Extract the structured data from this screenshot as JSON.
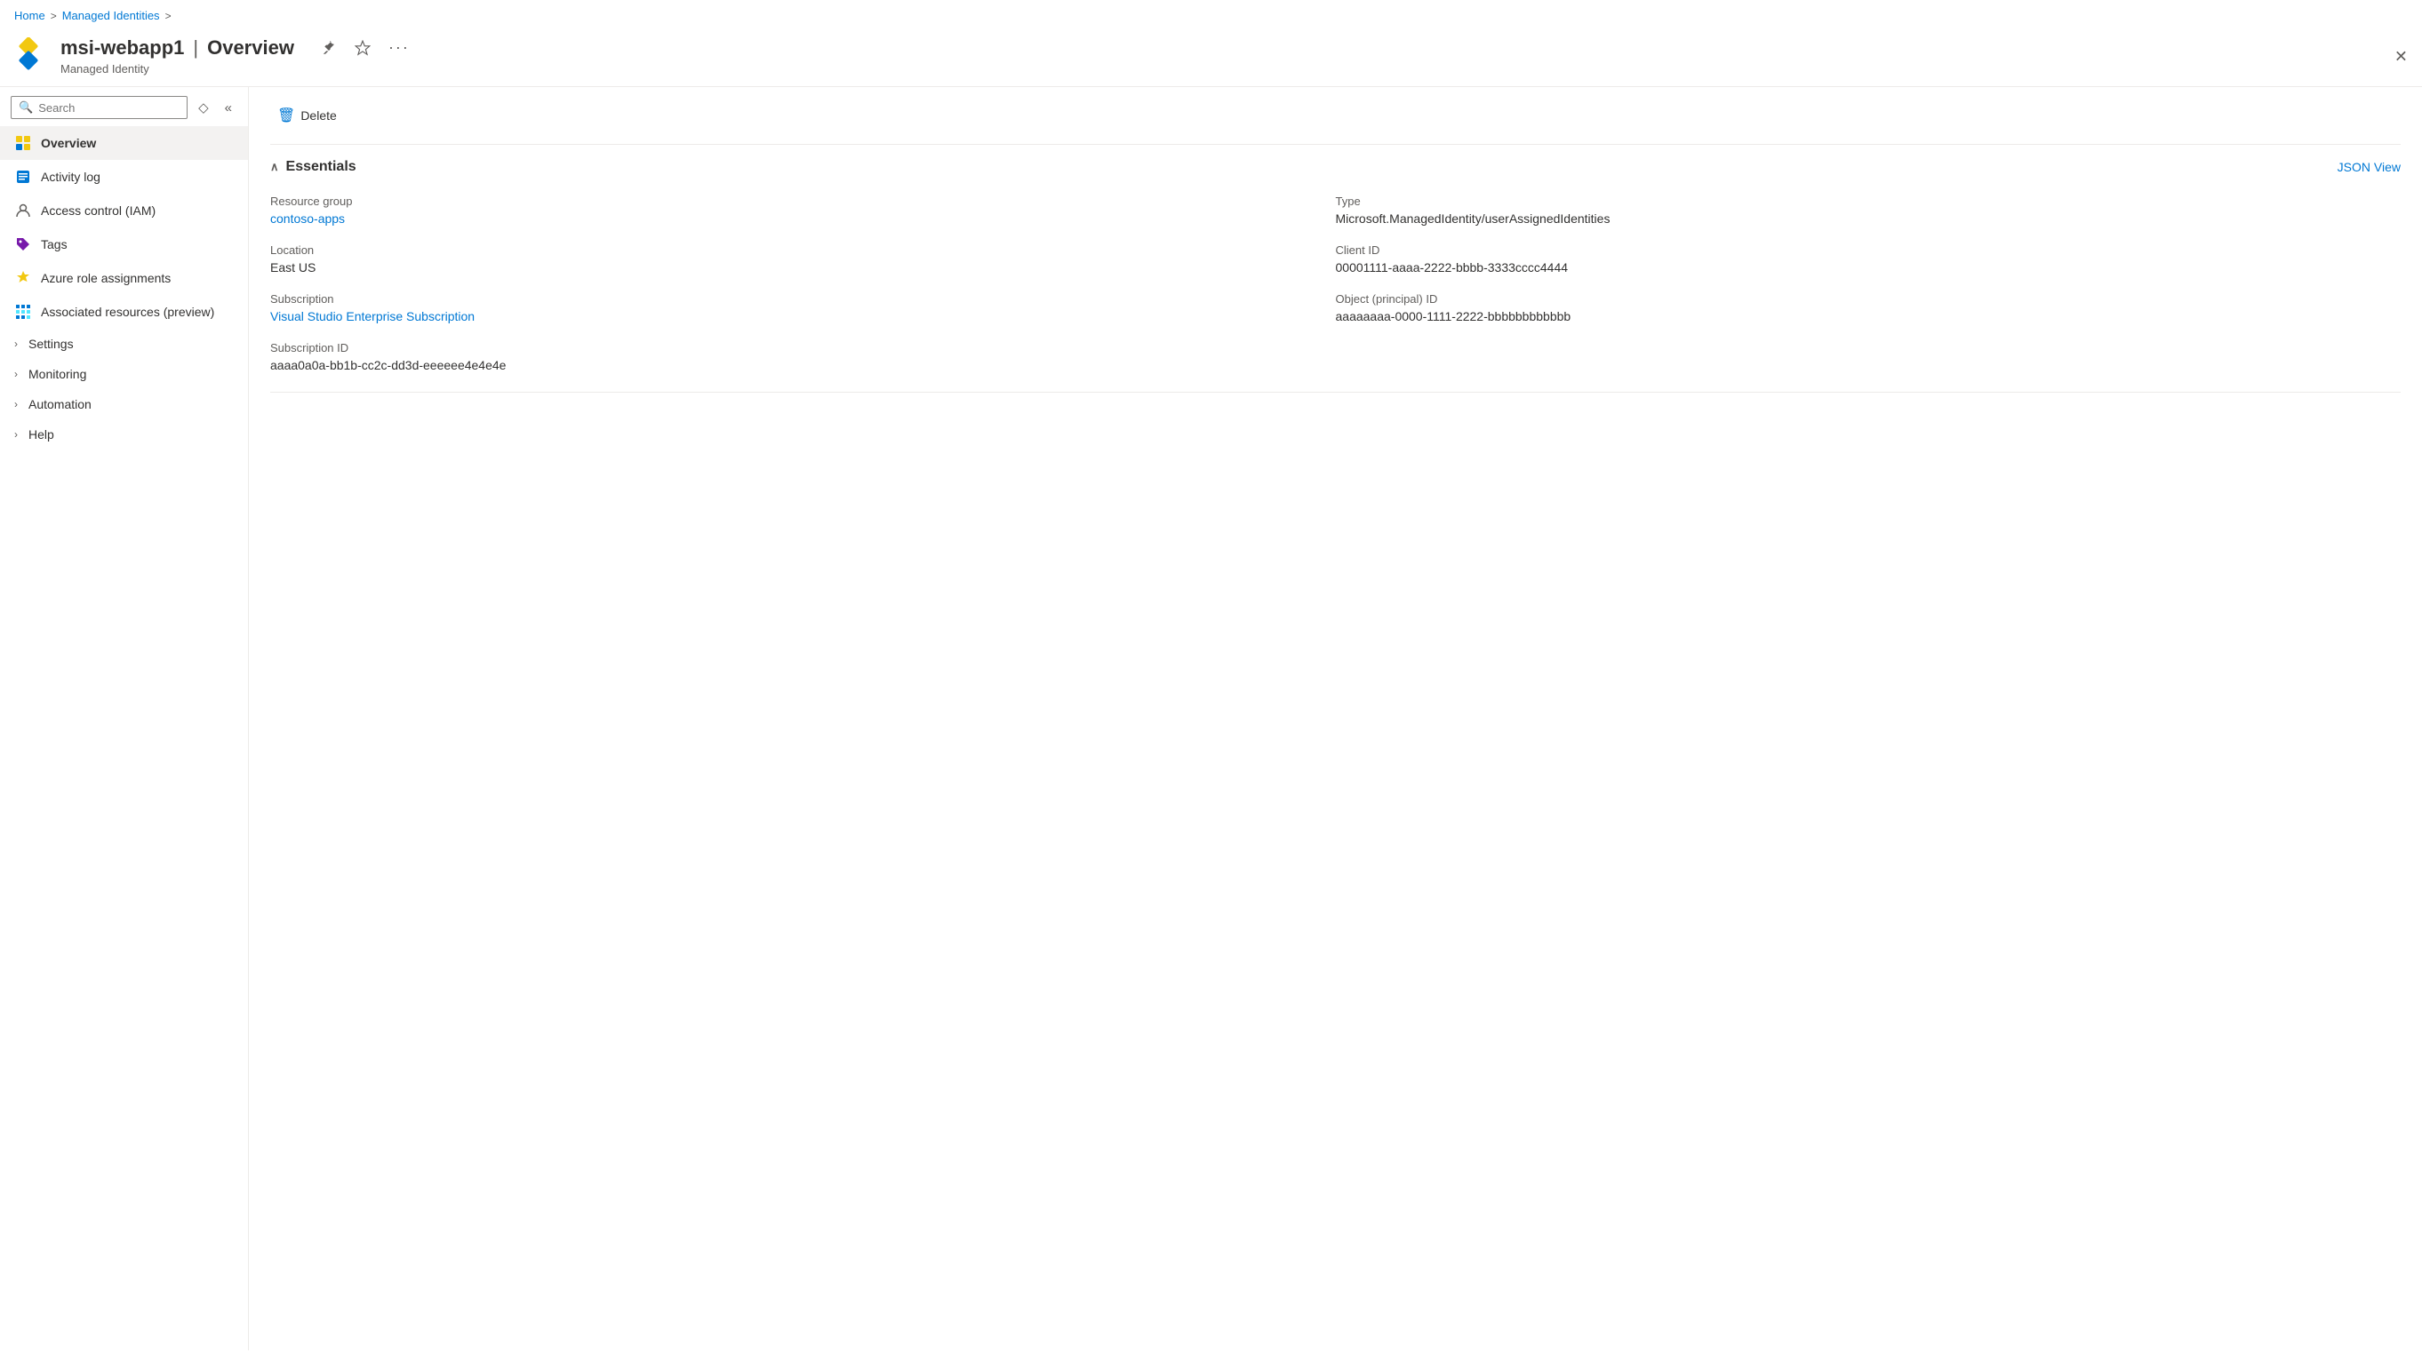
{
  "breadcrumb": {
    "home": "Home",
    "managed_identities": "Managed Identities",
    "sep": ">"
  },
  "header": {
    "resource_name": "msi-webapp1",
    "separator": "|",
    "page_title": "Overview",
    "subtitle": "Managed Identity",
    "pin_tooltip": "Pin to dashboard",
    "star_tooltip": "Favorite",
    "more_tooltip": "More options",
    "close_tooltip": "Close"
  },
  "sidebar": {
    "search_placeholder": "Search",
    "items": [
      {
        "id": "overview",
        "label": "Overview",
        "icon": "overview-icon",
        "active": true,
        "expandable": false
      },
      {
        "id": "activity-log",
        "label": "Activity log",
        "icon": "activity-log-icon",
        "active": false,
        "expandable": false
      },
      {
        "id": "access-control",
        "label": "Access control (IAM)",
        "icon": "iam-icon",
        "active": false,
        "expandable": false
      },
      {
        "id": "tags",
        "label": "Tags",
        "icon": "tags-icon",
        "active": false,
        "expandable": false
      },
      {
        "id": "azure-role-assignments",
        "label": "Azure role assignments",
        "icon": "role-icon",
        "active": false,
        "expandable": false
      },
      {
        "id": "associated-resources",
        "label": "Associated resources (preview)",
        "icon": "associated-icon",
        "active": false,
        "expandable": false
      }
    ],
    "expandable_items": [
      {
        "id": "settings",
        "label": "Settings"
      },
      {
        "id": "monitoring",
        "label": "Monitoring"
      },
      {
        "id": "automation",
        "label": "Automation"
      },
      {
        "id": "help",
        "label": "Help"
      }
    ]
  },
  "toolbar": {
    "delete_label": "Delete",
    "delete_icon": "trash-icon"
  },
  "essentials": {
    "title": "Essentials",
    "json_view_label": "JSON View",
    "fields": {
      "resource_group_label": "Resource group",
      "resource_group_value": "contoso-apps",
      "resource_group_link": "#",
      "type_label": "Type",
      "type_value": "Microsoft.ManagedIdentity/userAssignedIdentities",
      "location_label": "Location",
      "location_value": "East US",
      "client_id_label": "Client ID",
      "client_id_value": "00001111-aaaa-2222-bbbb-3333cccc4444",
      "subscription_label": "Subscription",
      "subscription_value": "Visual Studio Enterprise Subscription",
      "subscription_link": "#",
      "object_id_label": "Object (principal) ID",
      "object_id_value": "aaaaaaaa-0000-1111-2222-bbbbbbbbbbbb",
      "subscription_id_label": "Subscription ID",
      "subscription_id_value": "aaaa0a0a-bb1b-cc2c-dd3d-eeeeee4e4e4e"
    }
  }
}
